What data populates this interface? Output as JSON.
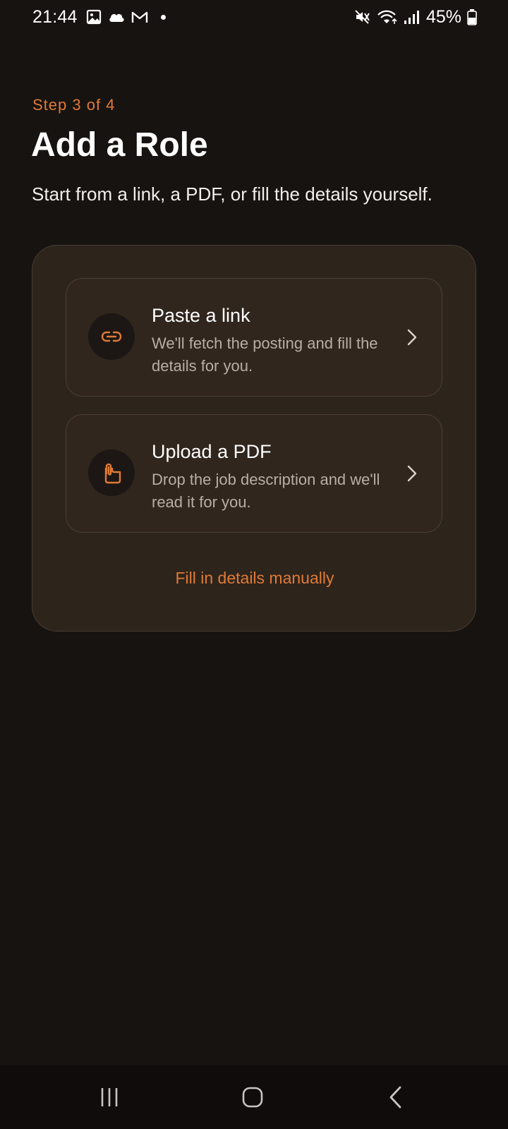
{
  "status_bar": {
    "time": "21:44",
    "battery": "45%",
    "icons": [
      "gallery-icon",
      "cloud-icon",
      "gmail-icon",
      "notification-dot",
      "mute-icon",
      "wifi-icon",
      "signal-icon",
      "battery-icon"
    ]
  },
  "header": {
    "step": "Step 3 of 4",
    "title": "Add a Role",
    "subtitle": "Start from a link, a PDF, or fill the details yourself."
  },
  "options": [
    {
      "title": "Paste a link",
      "description": "We'll fetch the posting and fill the details for you.",
      "icon": "link-icon"
    },
    {
      "title": "Upload a PDF",
      "description": "Drop the job description and we'll read it for you.",
      "icon": "document-icon"
    }
  ],
  "manual_link": "Fill in details manually",
  "colors": {
    "accent": "#e07a36",
    "background": "#171311",
    "panel": "#2d241c",
    "card": "#30261d"
  },
  "nav_bar": {
    "buttons": [
      "recent-apps-icon",
      "home-icon",
      "back-icon"
    ]
  }
}
